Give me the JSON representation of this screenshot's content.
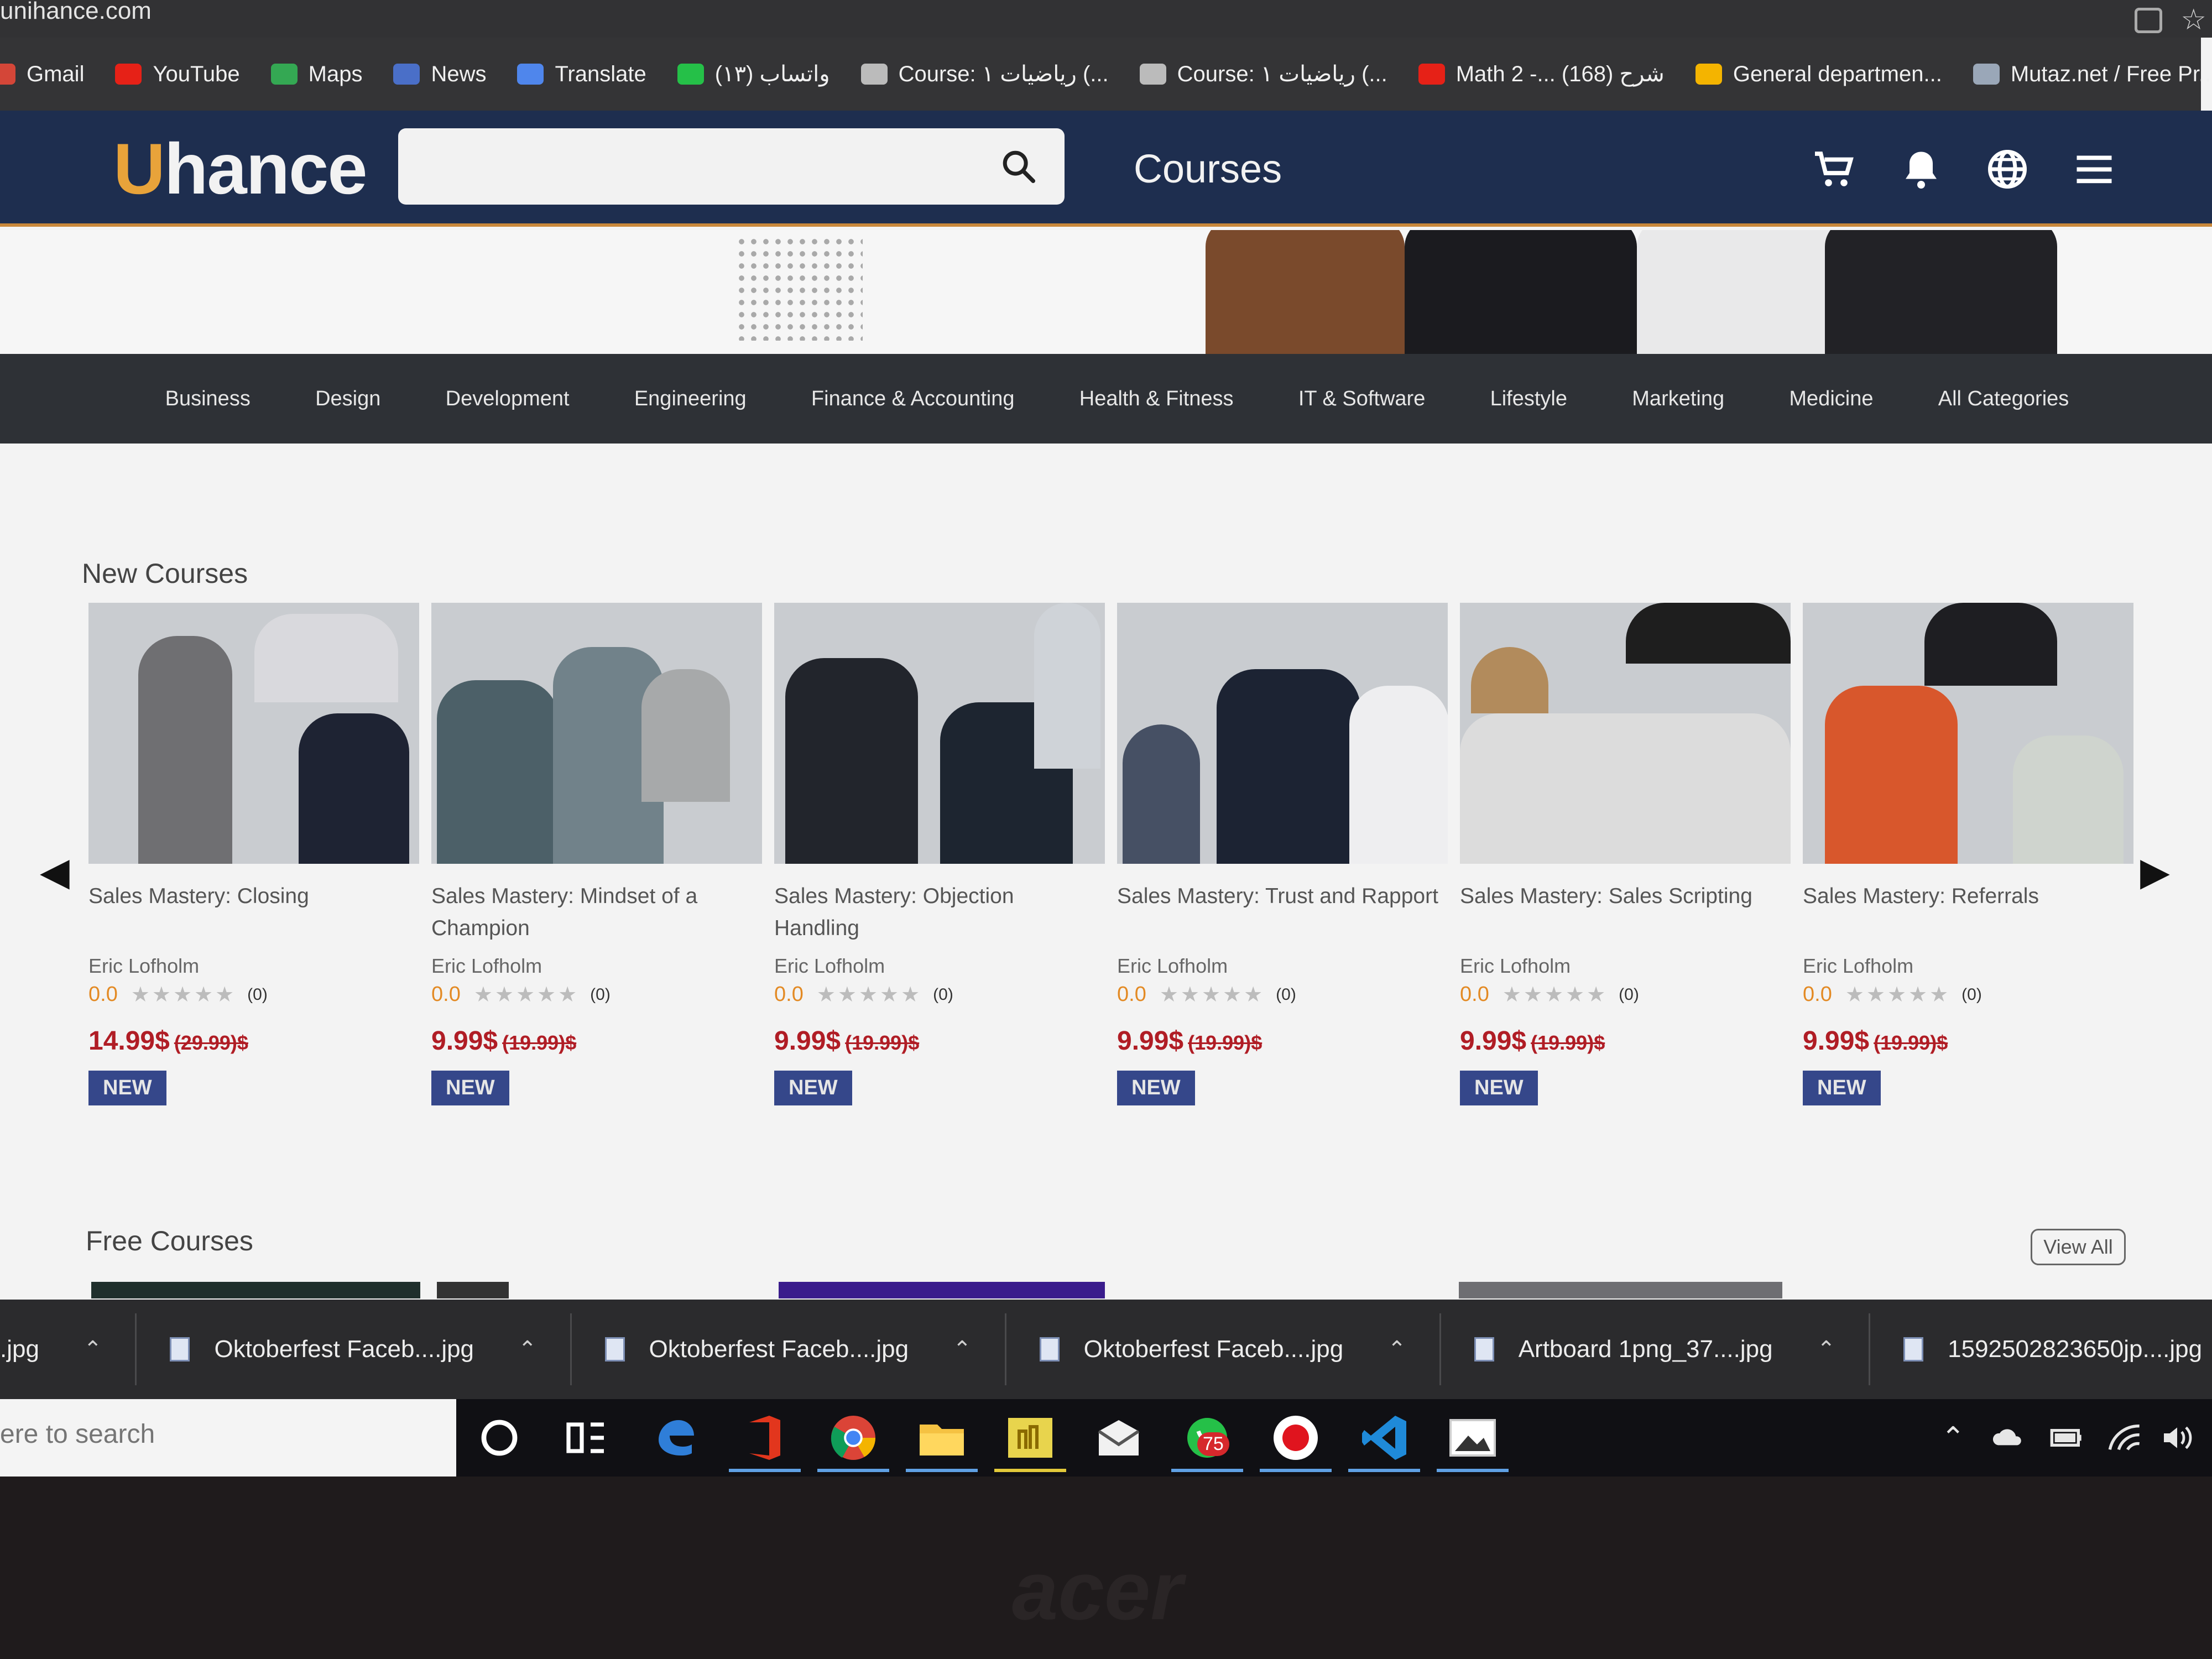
{
  "browser": {
    "url": "unihance.com",
    "bookmarks": [
      {
        "label": "Gmail",
        "icon": "gmail-icon",
        "color": "#d44638"
      },
      {
        "label": "YouTube",
        "icon": "youtube-icon",
        "color": "#e62117"
      },
      {
        "label": "Maps",
        "icon": "maps-icon",
        "color": "#34a853"
      },
      {
        "label": "News",
        "icon": "news-icon",
        "color": "#4a6fc8"
      },
      {
        "label": "Translate",
        "icon": "translate-icon",
        "color": "#4f86ec"
      },
      {
        "label": "واتساب (١٣)",
        "icon": "whatsapp-icon",
        "color": "#25c048"
      },
      {
        "label": "Course: رياضيات ١ (...",
        "icon": "course-icon",
        "color": "#bbbbbb"
      },
      {
        "label": "Course: رياضيات ١ (...",
        "icon": "course-icon",
        "color": "#bbbbbb"
      },
      {
        "label": "Math 2 -... شرح (168)",
        "icon": "youtube-icon",
        "color": "#e62117"
      },
      {
        "label": "General departmen...",
        "icon": "drive-icon",
        "color": "#f4b400"
      },
      {
        "label": "Mutaz.net / Free Pr...",
        "icon": "mutaz-icon",
        "color": "#9aa7b8"
      }
    ]
  },
  "header": {
    "logo_u": "U",
    "logo_rest": "hance",
    "search_placeholder": "",
    "courses_label": "Courses",
    "icons": [
      "cart-icon",
      "bell-icon",
      "globe-icon",
      "menu-icon"
    ]
  },
  "categories": [
    "Business",
    "Design",
    "Development",
    "Engineering",
    "Finance & Accounting",
    "Health & Fitness",
    "IT & Software",
    "Lifestyle",
    "Marketing",
    "Medicine",
    "All Categories"
  ],
  "new_courses": {
    "title": "New Courses",
    "items": [
      {
        "title": "Sales Mastery: Closing",
        "author": "Eric Lofholm",
        "score": "0.0",
        "stars": "★★★★★",
        "count": "(0)",
        "price": "14.99$",
        "old_price": "(29.99)$",
        "badge": "NEW"
      },
      {
        "title": "Sales Mastery: Mindset of a Champion",
        "author": "Eric Lofholm",
        "score": "0.0",
        "stars": "★★★★★",
        "count": "(0)",
        "price": "9.99$",
        "old_price": "(19.99)$",
        "badge": "NEW"
      },
      {
        "title": "Sales Mastery: Objection Handling",
        "author": "Eric Lofholm",
        "score": "0.0",
        "stars": "★★★★★",
        "count": "(0)",
        "price": "9.99$",
        "old_price": "(19.99)$",
        "badge": "NEW"
      },
      {
        "title": "Sales Mastery: Trust and Rapport",
        "author": "Eric Lofholm",
        "score": "0.0",
        "stars": "★★★★★",
        "count": "(0)",
        "price": "9.99$",
        "old_price": "(19.99)$",
        "badge": "NEW"
      },
      {
        "title": "Sales Mastery: Sales Scripting",
        "author": "Eric Lofholm",
        "score": "0.0",
        "stars": "★★★★★",
        "count": "(0)",
        "price": "9.99$",
        "old_price": "(19.99)$",
        "badge": "NEW"
      },
      {
        "title": "Sales Mastery: Referrals",
        "author": "Eric Lofholm",
        "score": "0.0",
        "stars": "★★★★★",
        "count": "(0)",
        "price": "9.99$",
        "old_price": "(19.99)$",
        "badge": "NEW"
      }
    ]
  },
  "free_courses": {
    "title": "Free Courses",
    "view_all": "View All"
  },
  "downloads": [
    {
      "name": ".jpg"
    },
    {
      "name": "Oktoberfest Faceb....jpg"
    },
    {
      "name": "Oktoberfest Faceb....jpg"
    },
    {
      "name": "Oktoberfest Faceb....jpg"
    },
    {
      "name": "Artboard 1png_37....jpg"
    },
    {
      "name": "1592502823650jp....jpg"
    }
  ],
  "taskbar": {
    "search_text": "ere to search",
    "whatsapp_badge": "75"
  },
  "device_brand": "acer"
}
